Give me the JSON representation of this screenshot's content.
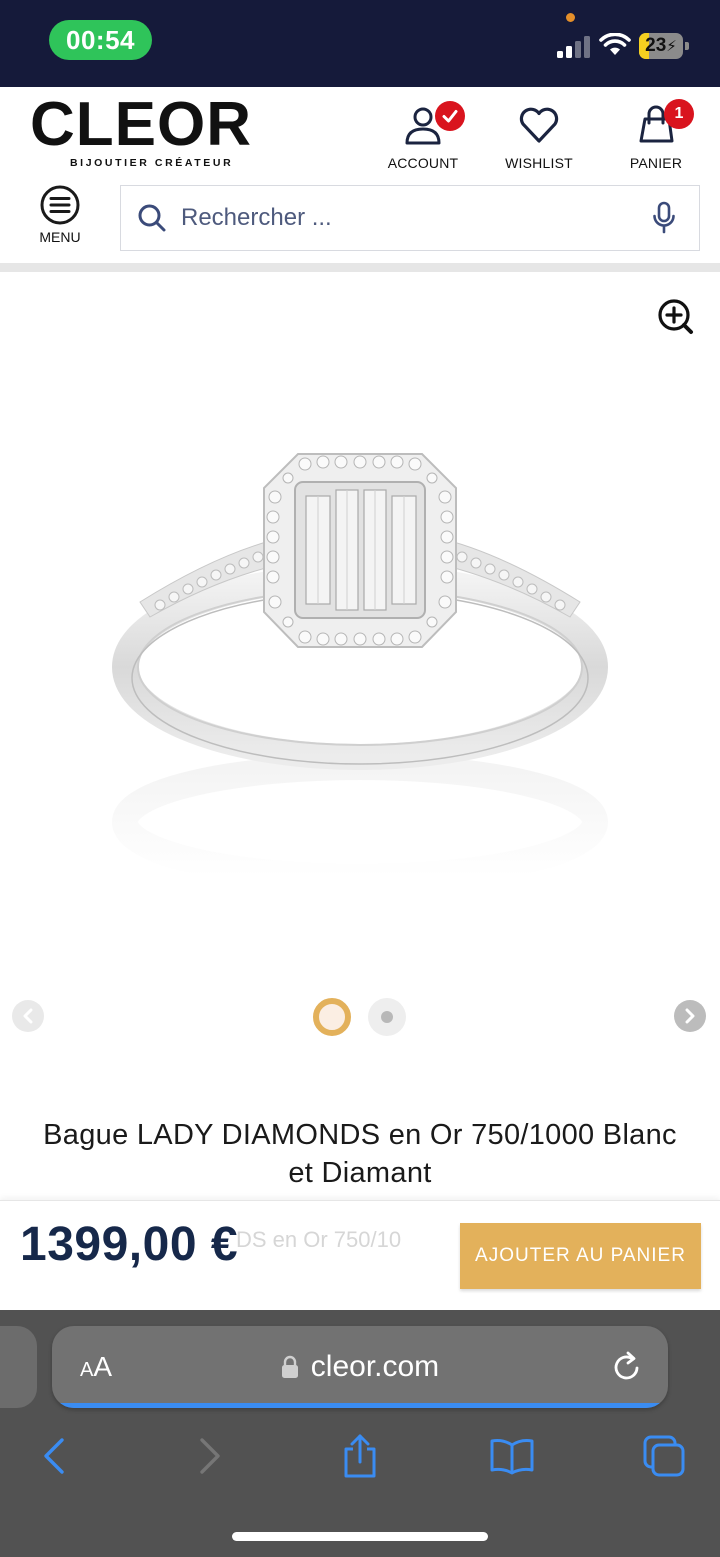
{
  "status_bar": {
    "time": "00:54",
    "battery": "23",
    "battery_level": 0.23,
    "time_pill_color": "#2fc45a"
  },
  "header": {
    "logo": "CLEOR",
    "tagline": "BIJOUTIER CRÉATEUR",
    "account_label": "ACCOUNT",
    "wishlist_label": "WISHLIST",
    "cart_label": "PANIER",
    "cart_count": "1",
    "menu_label": "MENU",
    "search_placeholder": "Rechercher ...",
    "badge_color": "#d9141e"
  },
  "gallery": {
    "image_icon": "diamond-halo-ring-image",
    "zoom_icon": "zoom-in-icon",
    "image_count": 2,
    "active_index": 0,
    "accent_color": "#e3b15b"
  },
  "product": {
    "title": "Bague LADY DIAMONDS en Or 750/1000 Blanc et Diamant",
    "sticky_ghost_title": "DS en Or 750/10",
    "price": "1399,00 €",
    "add_to_cart_label": "AJOUTER AU PANIER",
    "price_color": "#16284a"
  },
  "browser": {
    "text_size_label_small": "A",
    "text_size_label_large": "A",
    "domain": "cleor.com",
    "load_progress": 1.0
  }
}
